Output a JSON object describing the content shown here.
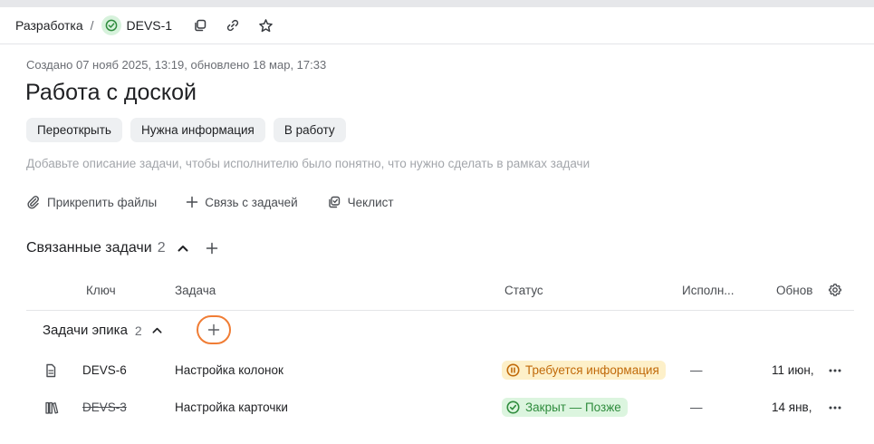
{
  "breadcrumb": {
    "project": "Разработка",
    "separator": "/",
    "issue_key": "DEVS-1"
  },
  "issue": {
    "meta": "Создано 07 нояб 2025, 13:19, обновлено 18 мар, 17:33",
    "title": "Работа с доской",
    "actions": [
      "Переоткрыть",
      "Нужна информация",
      "В работу"
    ],
    "description_placeholder": "Добавьте описание задачи, чтобы исполнителю было понятно, что нужно сделать в рамках задачи",
    "tools": {
      "attach": "Прикрепить файлы",
      "link": "Связь с задачей",
      "checklist": "Чеклист"
    }
  },
  "related": {
    "title": "Связанные задачи",
    "count": "2",
    "columns": {
      "key": "Ключ",
      "task": "Задача",
      "status": "Статус",
      "assignee": "Исполн...",
      "updated": "Обнов"
    },
    "epic": {
      "title": "Задачи эпика",
      "count": "2"
    },
    "rows": [
      {
        "icon": "document-icon",
        "key": "DEVS-6",
        "task": "Настройка колонок",
        "status": "Требуется информация",
        "assignee": "—",
        "updated": "11 июн,"
      },
      {
        "icon": "books-icon",
        "key": "DEVS-3",
        "task": "Настройка карточки",
        "status": "Закрыт — Позже",
        "assignee": "—",
        "updated": "14 янв,"
      }
    ]
  },
  "colors": {
    "accent_outline": "#f07d35",
    "status_need_bg": "#fdf0c9",
    "status_need_fg": "#c16a0a",
    "status_closed_bg": "#dcf5df",
    "status_closed_fg": "#2f8c3d"
  }
}
